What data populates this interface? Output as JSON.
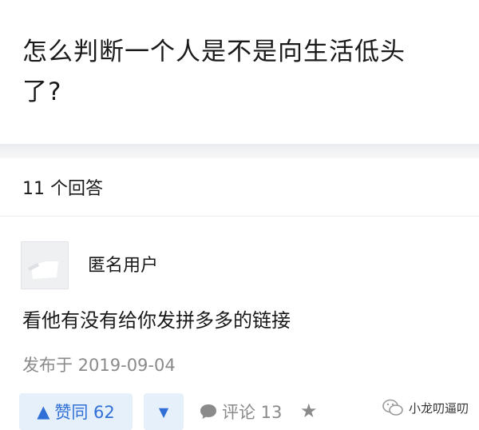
{
  "question": {
    "title": "怎么判断一个人是不是向生活低头了?"
  },
  "answers": {
    "count_label": "11 个回答"
  },
  "answer": {
    "username": "匿名用户",
    "content": "看他有没有给你发拼多多的链接",
    "date": "发布于 2019-09-04"
  },
  "actions": {
    "upvote_label": "赞同 62",
    "comment_label": "评论 13"
  },
  "watermark": {
    "text": "小龙叨逼叨"
  },
  "colors": {
    "accent": "#2f6fd6",
    "vote_bg": "#e6f0fb",
    "muted": "#8a8a8a"
  }
}
